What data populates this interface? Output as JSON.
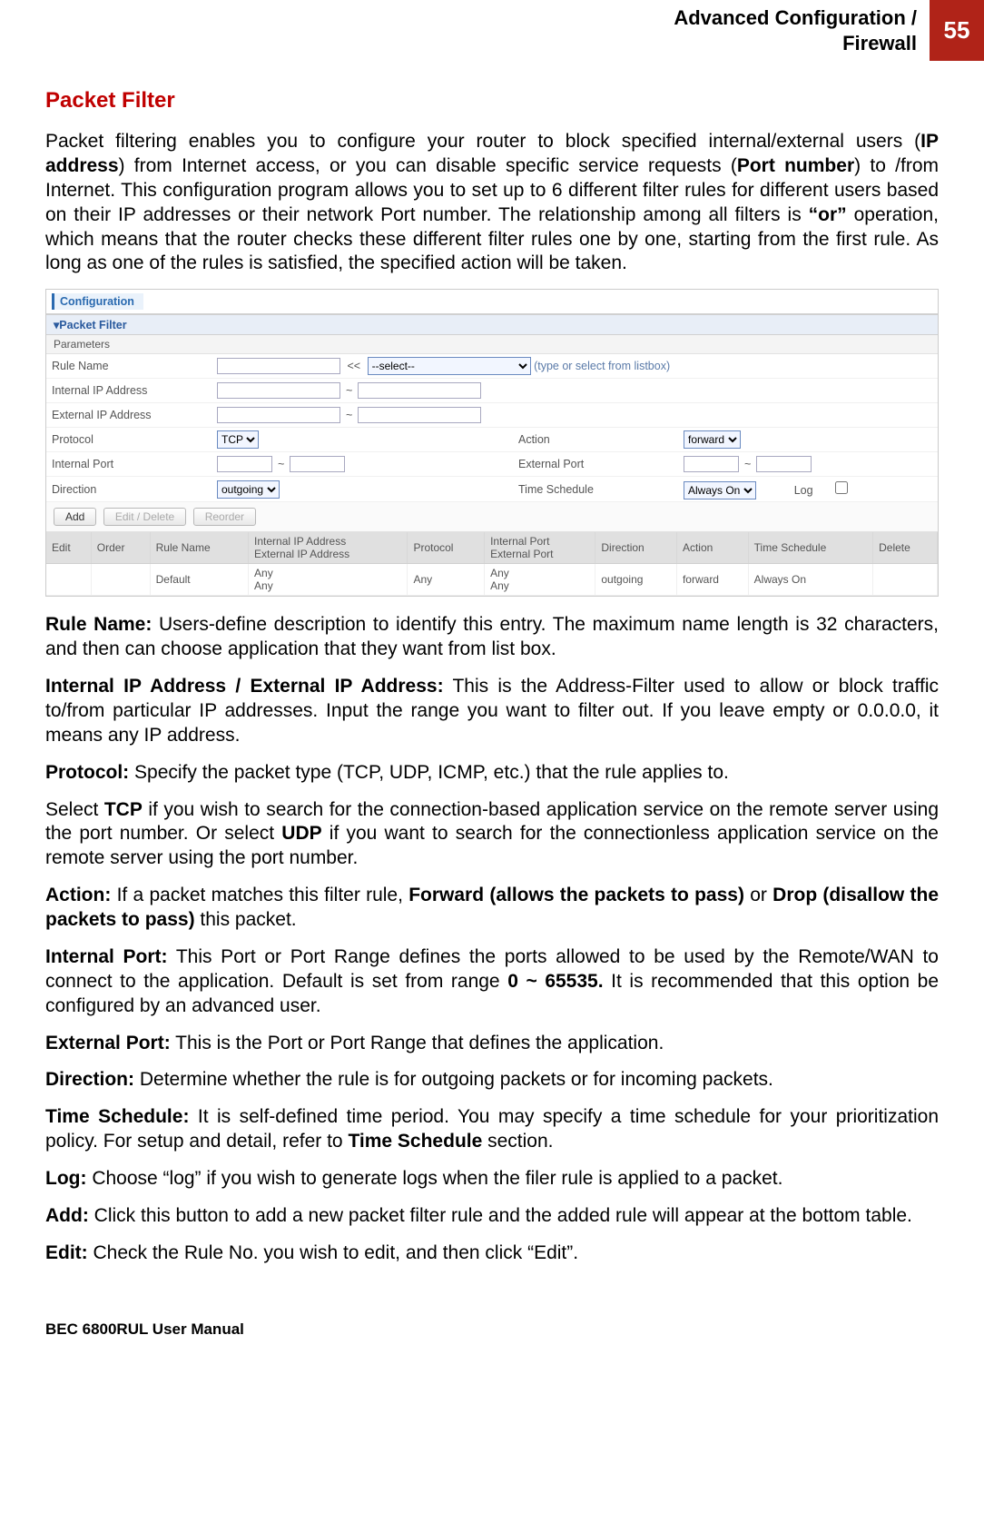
{
  "header": {
    "title_line1": "Advanced Configuration /",
    "title_line2": "Firewall",
    "page_number": "55"
  },
  "section": {
    "title": "Packet Filter",
    "intro_part1": "Packet filtering enables you to configure your router to block specified internal/external users (",
    "intro_bold1": "IP address",
    "intro_part2": ") from Internet access, or you can disable specific service requests (",
    "intro_bold2": "Port number",
    "intro_part3": ") to /from Internet. This configuration program allows you to set up to 6 different filter rules for different users based on their IP addresses or their network Port number. The relationship among all filters is ",
    "intro_bold3": "“or”",
    "intro_part4": " operation, which means that the router checks these different filter rules one by one, starting from the first rule. As long as one of the rules is satisfied, the specified action will be taken."
  },
  "config": {
    "tab": "Configuration",
    "panel_title": "▾Packet Filter",
    "parameters_label": "Parameters",
    "labels": {
      "rule_name": "Rule Name",
      "internal_ip": "Internal IP Address",
      "external_ip": "External IP Address",
      "protocol": "Protocol",
      "action": "Action",
      "internal_port": "Internal Port",
      "external_port": "External Port",
      "direction": "Direction",
      "time_schedule": "Time Schedule",
      "log": "Log"
    },
    "values": {
      "rule_name": "",
      "select_placeholder": "--select--",
      "select_hint": "(type or select from listbox)",
      "internal_ip_from": "",
      "internal_ip_to": "",
      "external_ip_from": "",
      "external_ip_to": "",
      "protocol": "TCP",
      "action": "forward",
      "internal_port_from": "",
      "internal_port_to": "",
      "external_port_from": "",
      "external_port_to": "",
      "direction": "outgoing",
      "time_schedule": "Always On",
      "lt_lt": "<<"
    },
    "buttons": {
      "add": "Add",
      "edit_delete": "Edit / Delete",
      "reorder": "Reorder"
    },
    "grid": {
      "headers": {
        "edit": "Edit",
        "order": "Order",
        "rule_name": "Rule Name",
        "ip_addr_top": "Internal IP Address",
        "ip_addr_bot": "External IP Address",
        "protocol": "Protocol",
        "port_top": "Internal Port",
        "port_bot": "External Port",
        "direction": "Direction",
        "action": "Action",
        "time_schedule": "Time Schedule",
        "delete": "Delete"
      },
      "row": {
        "edit": "",
        "order": "",
        "rule_name": "Default",
        "ip_top": "Any",
        "ip_bot": "Any",
        "protocol": "Any",
        "port_top": "Any",
        "port_bot": "Any",
        "direction": "outgoing",
        "action": "forward",
        "time_schedule": "Always On",
        "delete": ""
      }
    }
  },
  "defs": {
    "rule_name": {
      "label": "Rule Name:",
      "text": " Users-define description to identify this entry. The maximum name length is 32 characters, and then can choose application that they want from list box."
    },
    "ip": {
      "label": "Internal IP Address / External IP Address:",
      "text": " This is the Address-Filter used to allow or block traffic to/from particular IP addresses. Input the range you want to filter out. If you leave empty or 0.0.0.0, it means any IP address."
    },
    "protocol": {
      "label": "Protocol:",
      "text": " Specify the packet type (TCP, UDP, ICMP, etc.) that the rule applies to."
    },
    "protocol2_pre": "Select ",
    "protocol2_bold1": "TCP",
    "protocol2_mid": " if you wish to search for the connection-based application service on the remote server using the port number. Or select ",
    "protocol2_bold2": "UDP",
    "protocol2_post": " if you want to search for the connectionless application service on the remote server using the port number.",
    "action": {
      "label": "Action:",
      "text1": " If a packet matches this filter rule, ",
      "bold1": "Forward (allows the packets to pass)",
      "text2": " or ",
      "bold2": "Drop (disallow the packets to pass)",
      "text3": " this packet."
    },
    "internal_port": {
      "label": "Internal Port:",
      "text1": " This Port or Port Range defines the ports allowed to be used by the Remote/WAN to connect to the application. Default is set from range ",
      "bold": "0 ~ 65535.",
      "text2": " It is recommended that this option be configured by an advanced user."
    },
    "external_port": {
      "label": "External Port:",
      "text": " This is the Port or Port Range that defines the application."
    },
    "direction": {
      "label": "Direction:",
      "text": " Determine whether the rule is for outgoing packets or for incoming packets."
    },
    "time_schedule": {
      "label": "Time Schedule:",
      "text1": " It is self-defined time period. You may specify a time schedule for your prioritization policy. For setup and detail, refer to ",
      "bold": "Time Schedule",
      "text2": " section."
    },
    "log": {
      "label": "Log:",
      "text": " Choose “log” if you wish to generate logs when the filer rule is applied to a packet."
    },
    "add": {
      "label": "Add:",
      "text": " Click this button to add a new packet filter rule and the added rule will appear at the bottom table."
    },
    "edit": {
      "label": "Edit:",
      "text": " Check the Rule No. you wish to edit, and then click “Edit”."
    }
  },
  "footer": "BEC 6800RUL User Manual"
}
